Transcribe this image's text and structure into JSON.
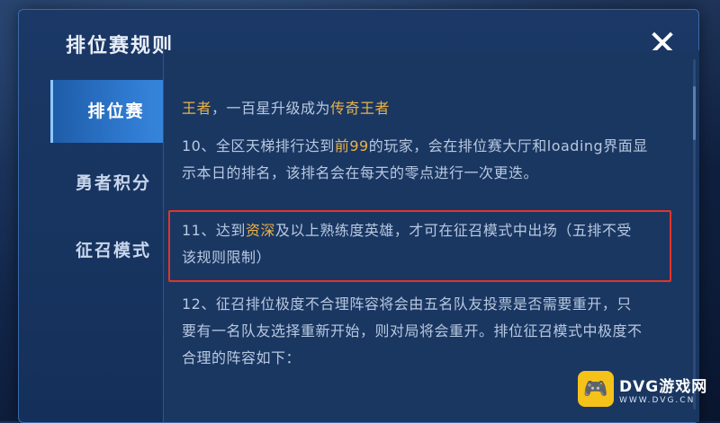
{
  "dialog": {
    "title": "排位赛规则",
    "close_icon": "close-icon"
  },
  "tabs": [
    {
      "label": "排位赛",
      "active": true
    },
    {
      "label": "勇者积分",
      "active": false
    },
    {
      "label": "征召模式",
      "active": false
    }
  ],
  "content": {
    "p1_gold1": "王者",
    "p1_text": "，一百星升级成为",
    "p1_gold2": "传奇王者",
    "p2_line1_a": "10、全区天梯排行达到",
    "p2_line1_gold": "前99",
    "p2_line1_b": "的玩家，会在排位赛大厅和loading界面显",
    "p2_line2": "示本日的排名，该排名会在每天的零点进行一次更迭。",
    "p3_line1_a": "11、达到",
    "p3_line1_gold": "资深",
    "p3_line1_b": "及以上熟练度英雄，才可在征召模式中出场（五排不受",
    "p3_line2": "该规则限制）",
    "p4_line1": "12、征召排位极度不合理阵容将会由五名队友投票是否需要重开，只",
    "p4_line2": "要有一名队友选择重新开始，则对局将会重开。排位征召模式中极度不",
    "p4_line3": "合理的阵容如下："
  },
  "watermark": {
    "main": "DVG游戏网",
    "sub": "WWW.DVG.CN",
    "logo_icon": "gamepad-icon"
  },
  "colors": {
    "accent_gold": "#e8b24a",
    "highlight_red": "#e0352b",
    "active_tab": "#2f7ad0"
  }
}
